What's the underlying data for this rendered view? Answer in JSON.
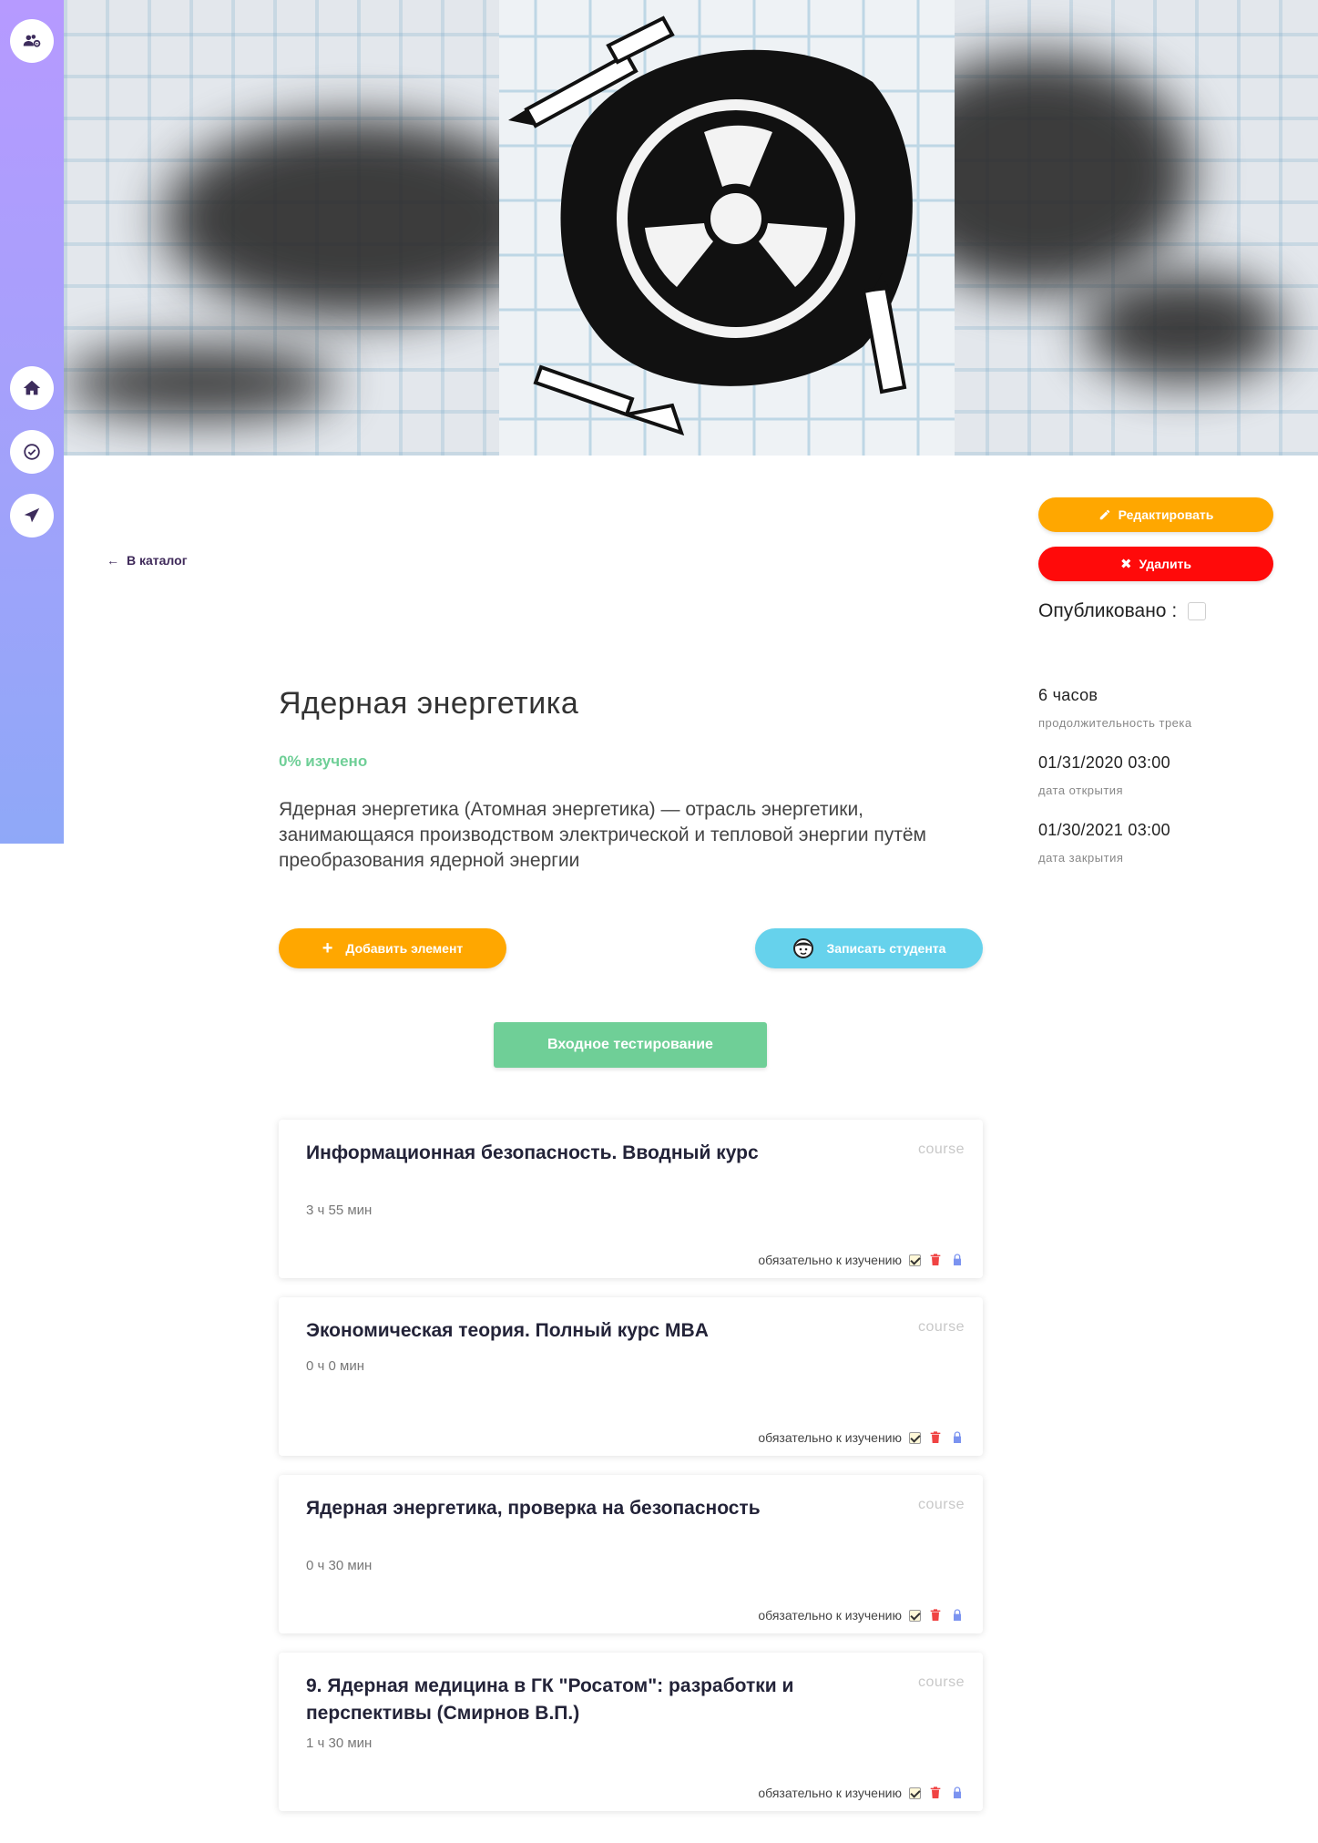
{
  "sidebar": {
    "items": [
      {
        "name": "users-settings-icon"
      },
      {
        "name": "home-icon"
      },
      {
        "name": "check-circle-icon"
      },
      {
        "name": "navigation-arrow-icon"
      }
    ]
  },
  "header": {
    "back_label": "В каталог",
    "edit_label": "Редактировать",
    "delete_label": "Удалить",
    "published_label": "Опубликовано :"
  },
  "meta": {
    "duration_value": "6 часов",
    "duration_label": "продолжительность трека",
    "open_value": "01/31/2020 03:00",
    "open_label": "дата открытия",
    "close_value": "01/30/2021 03:00",
    "close_label": "дата закрытия"
  },
  "track": {
    "title": "Ядерная энергетика",
    "progress": "0% изучено",
    "description": "Ядерная энергетика (Атомная энергетика) — отрасль энергетики, занимающаяся производством электрической и тепловой энергии путём преобразования ядерной энергии"
  },
  "actions": {
    "add_label": "Добавить элемент",
    "enroll_label": "Записать студента",
    "test_label": "Входное тестирование"
  },
  "cards": [
    {
      "title": "Информационная безопасность. Вводный курс",
      "type": "course",
      "duration": "3 ч 55 мин",
      "required_label": "обязательно к изучению"
    },
    {
      "title": "Экономическая теория. Полный курс MBA",
      "type": "course",
      "duration": "0 ч 0 мин",
      "required_label": "обязательно к изучению"
    },
    {
      "title": "Ядерная энергетика, проверка на безопасность",
      "type": "course",
      "duration": "0 ч 30 мин",
      "required_label": "обязательно к изучению"
    },
    {
      "title": "9. Ядерная медицина в ГК \"Росатом\": разработки и перспективы (Смирнов В.П.)",
      "type": "course",
      "duration": "1 ч 30 мин",
      "required_label": "обязательно к изучению"
    }
  ],
  "colors": {
    "orange": "#ffa700",
    "red": "#ff0a0a",
    "green": "#6fcf97",
    "cyan": "#66d2ec",
    "lock": "#7b93f0"
  }
}
